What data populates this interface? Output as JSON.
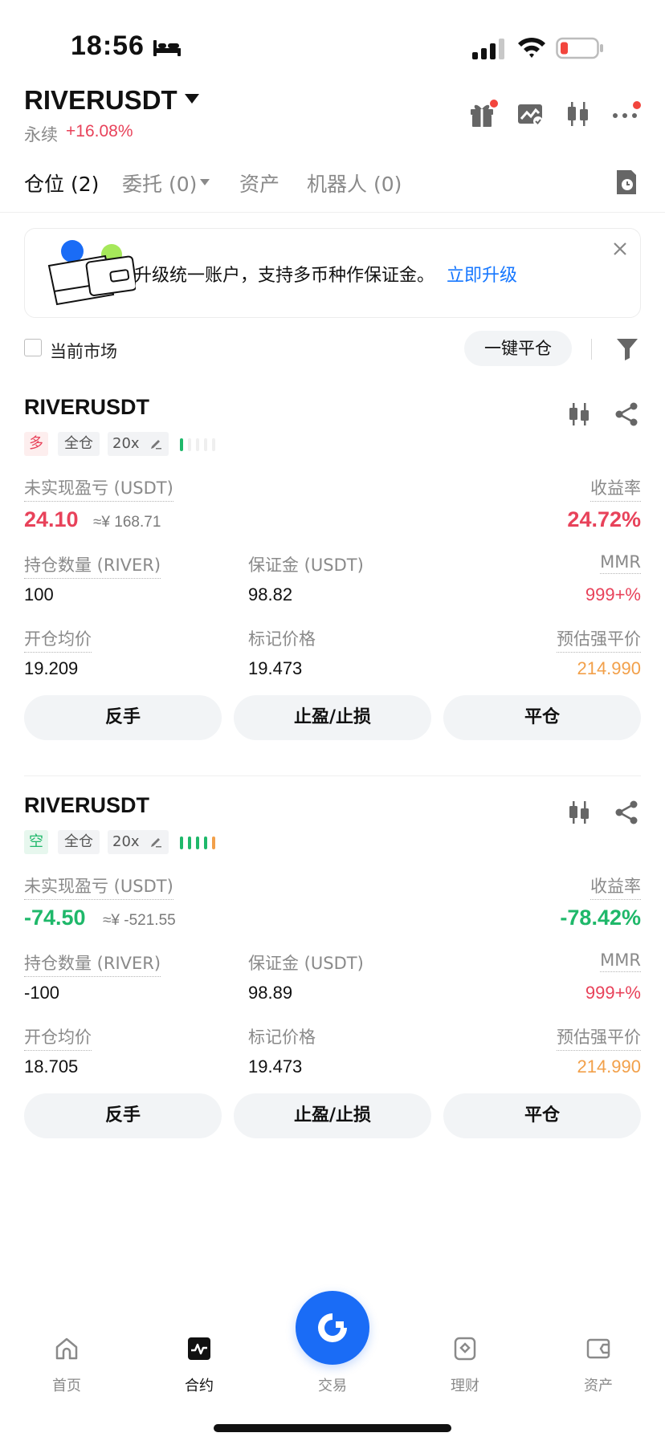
{
  "status_bar": {
    "time": "18:56"
  },
  "header": {
    "symbol": "RIVERUSDT",
    "type_label": "永续",
    "change": "+16.08%"
  },
  "tabs": [
    {
      "label": "仓位 (2)"
    },
    {
      "label": "委托 (0)"
    },
    {
      "label": "资产"
    },
    {
      "label": "机器人 (0)"
    }
  ],
  "banner": {
    "text": "升级统一账户，支持多币种作保证金。",
    "link": "立即升级"
  },
  "filter": {
    "current_market_label": "当前市场",
    "close_all_label": "一键平仓"
  },
  "positions": [
    {
      "symbol": "RIVERUSDT",
      "side": "多",
      "margin_mode": "全仓",
      "leverage": "20x",
      "pnl_label": "未实现盈亏 (USDT)",
      "pnl": "24.10",
      "pnl_cny": "≈¥ 168.71",
      "roe_label": "收益率",
      "roe": "24.72%",
      "qty_label": "持仓数量 (RIVER)",
      "qty": "100",
      "margin_label": "保证金 (USDT)",
      "margin": "98.82",
      "mmr_label": "MMR",
      "mmr": "999+%",
      "entry_label": "开仓均价",
      "entry": "19.209",
      "mark_label": "标记价格",
      "mark": "19.473",
      "liq_label": "预估强平价",
      "liq": "214.990",
      "btn_reverse": "反手",
      "btn_tpsl": "止盈/止损",
      "btn_close": "平仓"
    },
    {
      "symbol": "RIVERUSDT",
      "side": "空",
      "margin_mode": "全仓",
      "leverage": "20x",
      "pnl_label": "未实现盈亏 (USDT)",
      "pnl": "-74.50",
      "pnl_cny": "≈¥ -521.55",
      "roe_label": "收益率",
      "roe": "-78.42%",
      "qty_label": "持仓数量 (RIVER)",
      "qty": "-100",
      "margin_label": "保证金 (USDT)",
      "margin": "98.89",
      "mmr_label": "MMR",
      "mmr": "999+%",
      "entry_label": "开仓均价",
      "entry": "18.705",
      "mark_label": "标记价格",
      "mark": "19.473",
      "liq_label": "预估强平价",
      "liq": "214.990",
      "btn_reverse": "反手",
      "btn_tpsl": "止盈/止损",
      "btn_close": "平仓"
    }
  ],
  "bottom_nav": [
    {
      "label": "首页",
      "icon": "home-icon"
    },
    {
      "label": "合约",
      "icon": "futures-icon"
    },
    {
      "label": "交易",
      "icon": "trade-icon"
    },
    {
      "label": "理财",
      "icon": "earn-icon"
    },
    {
      "label": "资产",
      "icon": "wallet-icon"
    }
  ],
  "colors": {
    "up": "#e8425a",
    "down": "#1fb86a",
    "accent": "#1a6cf6",
    "link": "#1677ff",
    "warning": "#f2a04a"
  }
}
